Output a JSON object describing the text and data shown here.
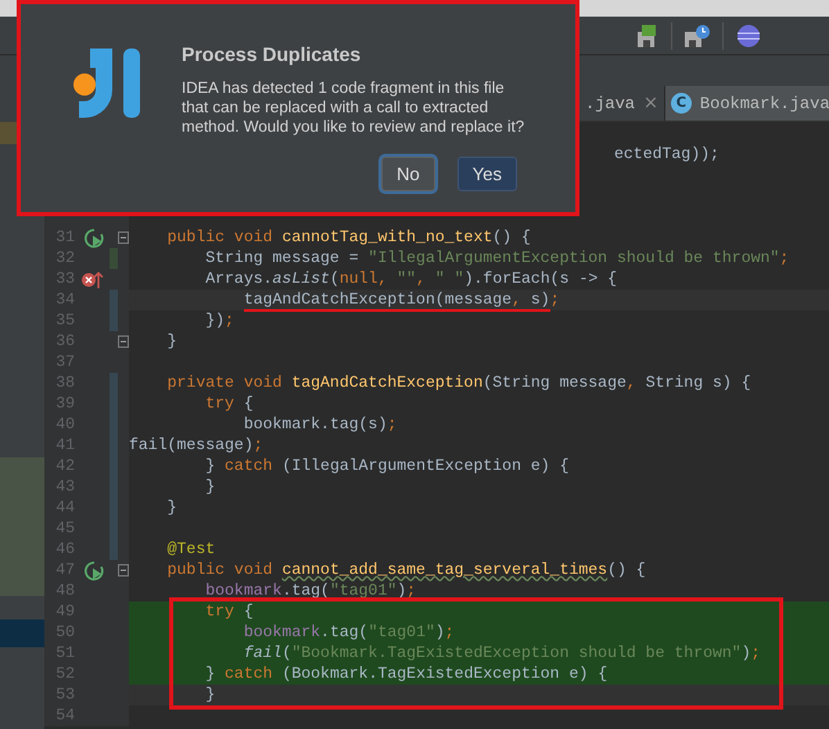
{
  "tabs": [
    {
      "label": ".java",
      "close": "×",
      "selected": false
    },
    {
      "label": "Bookmark.java",
      "icon_text": "C",
      "selected": true
    }
  ],
  "editor": {
    "covered_line_tail": "ectedTag));",
    "lines": [
      {
        "number": "31",
        "runnable": true,
        "fold": true,
        "tokens": [
          {
            "kind": "keyword",
            "text": "    public void "
          },
          {
            "kind": "method",
            "text": "cannotTag_with_no_text"
          },
          {
            "kind": "plain",
            "text": "() {"
          }
        ]
      },
      {
        "number": "32",
        "added": true,
        "tokens": [
          {
            "kind": "plain",
            "text": "        String message = "
          },
          {
            "kind": "string",
            "text": "\"IllegalArgumentException should be thrown\""
          },
          {
            "kind": "keyword",
            "text": ";"
          }
        ]
      },
      {
        "number": "33",
        "has_error": true,
        "tokens": [
          {
            "kind": "plain",
            "text": "        Arrays."
          },
          {
            "kind": "static",
            "text": "asList"
          },
          {
            "kind": "plain",
            "text": "("
          },
          {
            "kind": "keyword",
            "text": "null, "
          },
          {
            "kind": "string",
            "text": "\"\""
          },
          {
            "kind": "keyword",
            "text": ", "
          },
          {
            "kind": "string",
            "text": "\" \""
          },
          {
            "kind": "plain",
            "text": ").forEach(s -> {"
          }
        ]
      },
      {
        "number": "34",
        "modified": true,
        "current": true,
        "tokens": [
          {
            "kind": "plain",
            "text": "            tagAndCatchException(message",
            "marked": true
          },
          {
            "kind": "keyword",
            "text": ", ",
            "marked": true
          },
          {
            "kind": "plain",
            "text": "s)",
            "marked": true
          },
          {
            "kind": "keyword",
            "text": ";"
          }
        ]
      },
      {
        "number": "35",
        "modified": true,
        "tokens": [
          {
            "kind": "plain",
            "text": "        })"
          },
          {
            "kind": "keyword",
            "text": ";"
          }
        ]
      },
      {
        "number": "36",
        "fold": true,
        "tokens": [
          {
            "kind": "plain",
            "text": "    }"
          }
        ]
      },
      {
        "number": "37"
      },
      {
        "number": "38",
        "modified": true,
        "tokens": [
          {
            "kind": "keyword",
            "text": "    private void "
          },
          {
            "kind": "method",
            "text": "tagAndCatchException"
          },
          {
            "kind": "plain",
            "text": "(String message"
          },
          {
            "kind": "keyword",
            "text": ", "
          },
          {
            "kind": "plain",
            "text": "String s) {"
          }
        ]
      },
      {
        "number": "39",
        "modified": true,
        "tokens": [
          {
            "kind": "keyword",
            "text": "        try "
          },
          {
            "kind": "plain",
            "text": "{"
          }
        ]
      },
      {
        "number": "40",
        "modified": true,
        "tokens": [
          {
            "kind": "plain",
            "text": "            bookmark.tag(s)"
          },
          {
            "kind": "keyword",
            "text": ";"
          }
        ]
      },
      {
        "number": "41",
        "modified": true,
        "tokens": [
          {
            "kind": "plain",
            "text": "fail(message)"
          },
          {
            "kind": "keyword",
            "text": ";"
          }
        ]
      },
      {
        "number": "42",
        "modified": true,
        "tokens": [
          {
            "kind": "plain",
            "text": "        } "
          },
          {
            "kind": "keyword",
            "text": "catch "
          },
          {
            "kind": "plain",
            "text": "(IllegalArgumentException e) {"
          }
        ]
      },
      {
        "number": "43",
        "modified": true,
        "tokens": [
          {
            "kind": "plain",
            "text": "        }"
          }
        ]
      },
      {
        "number": "44",
        "modified": true,
        "tokens": [
          {
            "kind": "plain",
            "text": "    }"
          }
        ]
      },
      {
        "number": "45",
        "modified": true
      },
      {
        "number": "46",
        "modified": true,
        "tokens": [
          {
            "kind": "annotation",
            "text": "    @Test"
          }
        ]
      },
      {
        "number": "47",
        "runnable": true,
        "fold": true,
        "tokens": [
          {
            "kind": "keyword",
            "text": "    public void "
          },
          {
            "kind": "method",
            "text": "cannot_add_same_tag_serveral_times",
            "misspelled": true
          },
          {
            "kind": "plain",
            "text": "() {"
          }
        ]
      },
      {
        "number": "48",
        "tokens": [
          {
            "kind": "field",
            "text": "        bookmark"
          },
          {
            "kind": "plain",
            "text": ".tag("
          },
          {
            "kind": "string",
            "text": "\"tag01\""
          },
          {
            "kind": "plain",
            "text": ")"
          },
          {
            "kind": "keyword",
            "text": ";"
          }
        ]
      },
      {
        "number": "49",
        "boxed": true,
        "highlighted": true,
        "tokens": [
          {
            "kind": "keyword",
            "text": "        try "
          },
          {
            "kind": "plain",
            "text": "{"
          }
        ]
      },
      {
        "number": "50",
        "boxed": true,
        "highlighted": true,
        "tokens": [
          {
            "kind": "field",
            "text": "            bookmark"
          },
          {
            "kind": "plain",
            "text": ".tag("
          },
          {
            "kind": "string",
            "text": "\"tag01\""
          },
          {
            "kind": "plain",
            "text": ")"
          },
          {
            "kind": "keyword",
            "text": ";"
          }
        ]
      },
      {
        "number": "51",
        "boxed": true,
        "highlighted": true,
        "tokens": [
          {
            "kind": "static",
            "text": "            fail"
          },
          {
            "kind": "plain",
            "text": "("
          },
          {
            "kind": "string",
            "text": "\"Bookmark.TagExistedException should be thrown\""
          },
          {
            "kind": "plain",
            "text": ")"
          },
          {
            "kind": "keyword",
            "text": ";"
          }
        ]
      },
      {
        "number": "52",
        "boxed": true,
        "highlighted": true,
        "tokens": [
          {
            "kind": "plain",
            "text": "        } "
          },
          {
            "kind": "keyword",
            "text": "catch "
          },
          {
            "kind": "plain",
            "text": "(Bookmark.TagExistedException e) {"
          }
        ]
      },
      {
        "number": "53",
        "boxed": true,
        "current": true,
        "tokens": [
          {
            "kind": "plain",
            "text": "        }"
          }
        ]
      },
      {
        "number": "54"
      }
    ]
  },
  "dialog": {
    "title": "Process Duplicates",
    "message": "IDEA has detected 1 code fragment in this file that can be replaced with a call to extracted method. Would you like to review and replace it?",
    "buttons": [
      {
        "label": "No",
        "focused": true,
        "default": false
      },
      {
        "label": "Yes",
        "focused": false,
        "default": true
      }
    ]
  }
}
